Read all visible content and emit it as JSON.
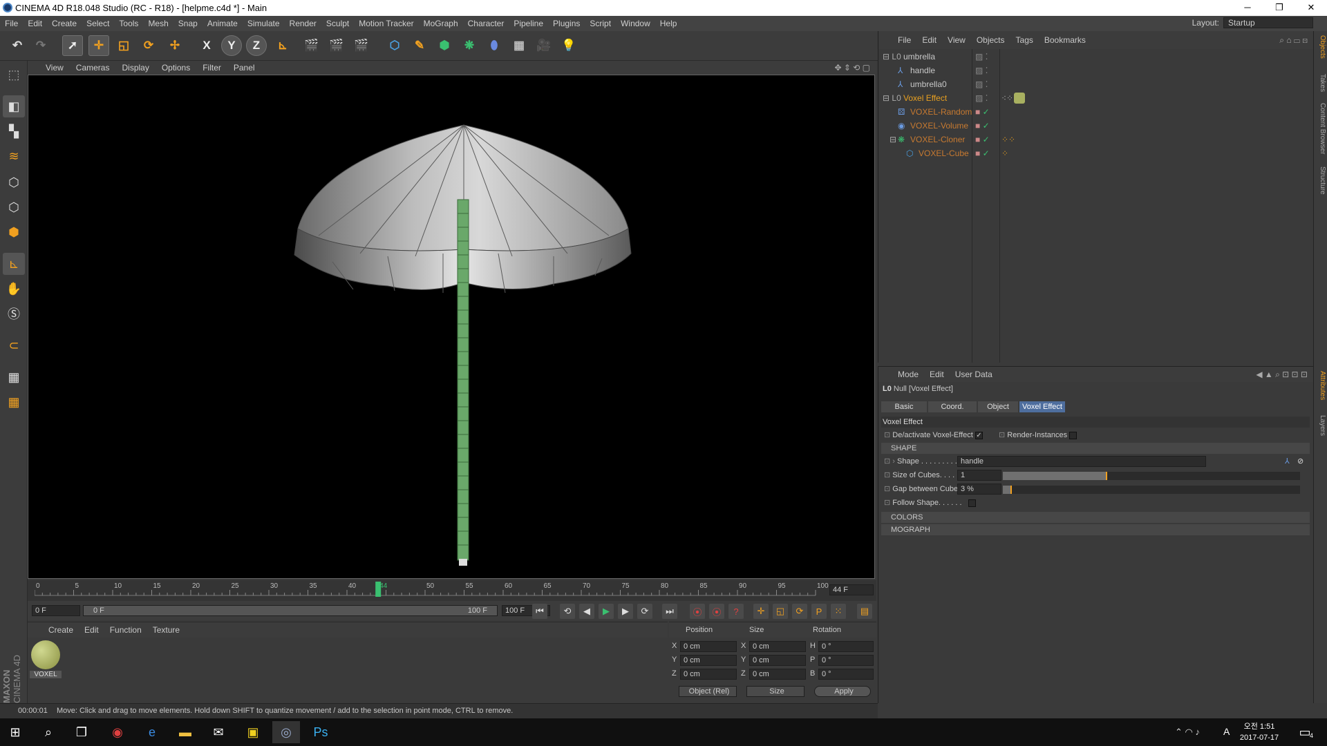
{
  "window": {
    "title": "CINEMA 4D R18.048 Studio (RC - R18) - [helpme.c4d *] - Main"
  },
  "menubar": [
    "File",
    "Edit",
    "Create",
    "Select",
    "Tools",
    "Mesh",
    "Snap",
    "Animate",
    "Simulate",
    "Render",
    "Sculpt",
    "Motion Tracker",
    "MoGraph",
    "Character",
    "Pipeline",
    "Plugins",
    "Script",
    "Window",
    "Help"
  ],
  "layout": {
    "label": "Layout:",
    "value": "Startup"
  },
  "viewport_menu": [
    "View",
    "Cameras",
    "Display",
    "Options",
    "Filter",
    "Panel"
  ],
  "toolbar": {
    "x": "X",
    "y": "Y",
    "z": "Z"
  },
  "timeline": {
    "ticks": [
      "0",
      "5",
      "10",
      "15",
      "20",
      "25",
      "30",
      "35",
      "40",
      "44",
      "50",
      "55",
      "60",
      "65",
      "70",
      "75",
      "80",
      "85",
      "90",
      "95",
      "100"
    ],
    "current_frame": "44 F",
    "start": "0 F",
    "range_start": "0 F",
    "range_end": "100 F",
    "end": "100 F",
    "playhead_fraction": 0.44
  },
  "materials": {
    "menu": [
      "Create",
      "Edit",
      "Function",
      "Texture"
    ],
    "items": [
      {
        "name": "VOXEL",
        "color": "#a8b060"
      }
    ]
  },
  "coords": {
    "headers": [
      "Position",
      "Size",
      "Rotation"
    ],
    "rows": [
      {
        "a": "X",
        "pos": "0 cm",
        "b": "X",
        "size": "0 cm",
        "c": "H",
        "rot": "0 °"
      },
      {
        "a": "Y",
        "pos": "0 cm",
        "b": "Y",
        "size": "0 cm",
        "c": "P",
        "rot": "0 °"
      },
      {
        "a": "Z",
        "pos": "0 cm",
        "b": "Z",
        "size": "0 cm",
        "c": "B",
        "rot": "0 °"
      }
    ],
    "mode": "Object (Rel)",
    "size_mode": "Size",
    "apply": "Apply"
  },
  "status": {
    "time": "00:00:01",
    "message": "Move: Click and drag to move elements. Hold down SHIFT to quantize movement / add to the selection in point mode, CTRL to remove."
  },
  "objects": {
    "menu": [
      "File",
      "Edit",
      "View",
      "Objects",
      "Tags",
      "Bookmarks"
    ],
    "items": [
      {
        "name": "umbrella",
        "color": "#cccccc"
      },
      {
        "name": "handle",
        "color": "#cccccc"
      },
      {
        "name": "umbrella0",
        "color": "#cccccc"
      },
      {
        "name": "Voxel Effect",
        "color": "#e8a020"
      },
      {
        "name": "VOXEL-Random",
        "color": "#c87a30"
      },
      {
        "name": "VOXEL-Volume",
        "color": "#c87a30"
      },
      {
        "name": "VOXEL-Cloner",
        "color": "#c87a30"
      },
      {
        "name": "VOXEL-Cube",
        "color": "#c87a30"
      }
    ]
  },
  "attributes": {
    "menu": [
      "Mode",
      "Edit",
      "User Data"
    ],
    "object_label": "Null [Voxel Effect]",
    "tabs": [
      "Basic",
      "Coord.",
      "Object",
      "Voxel Effect"
    ],
    "section_title": "Voxel Effect",
    "deactivate_label": "De/activate Voxel-Effect",
    "render_instances_label": "Render-Instances",
    "shape_section": "SHAPE",
    "shape_label": "Shape . . . . . . . . . .",
    "shape_value": "handle",
    "size_label": "Size of Cubes. . . . . .",
    "size_value": "1",
    "size_fraction": 0.35,
    "gap_label": "Gap between Cubes",
    "gap_value": "3 %",
    "gap_fraction": 0.03,
    "follow_label": "Follow Shape. . . . . .",
    "colors_section": "COLORS",
    "mograph_section": "MOGRAPH"
  },
  "right_tabs": [
    "Objects",
    "Takes",
    "Content Browser",
    "Structure",
    "Attributes",
    "Layers"
  ],
  "taskbar": {
    "time": "오전 1:51",
    "date": "2017-07-17",
    "ime": "A",
    "notif": "4"
  },
  "maxon": {
    "line1": "MAXON",
    "line2": "CINEMA 4D"
  }
}
